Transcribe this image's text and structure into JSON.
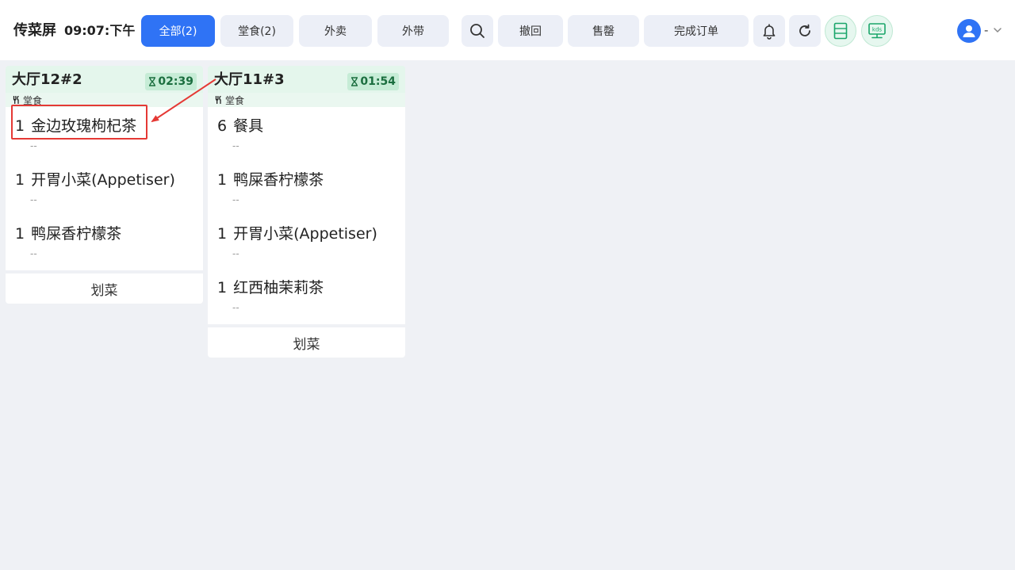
{
  "header": {
    "app_title": "传菜屏",
    "clock": "09:07:下午",
    "filters": [
      {
        "label": "全部(2)",
        "active": true
      },
      {
        "label": "堂食(2)",
        "active": false
      },
      {
        "label": "外卖",
        "active": false
      },
      {
        "label": "外带",
        "active": false
      }
    ],
    "actions": {
      "undo": "撤回",
      "sold_out": "售罄",
      "complete": "完成订单"
    },
    "icons": {
      "search": "search-icon",
      "bell": "bell-icon",
      "refresh": "refresh-icon",
      "list": "list-view-icon",
      "kds": "kds-icon",
      "kds_text": "kds"
    },
    "user": {
      "name": "-",
      "avatar": "user-avatar-icon"
    }
  },
  "orders": [
    {
      "title": "大厅12#2",
      "timer": "02:39",
      "type": "堂食",
      "items": [
        {
          "qty": "1",
          "name": "金边玫瑰枸杞茶",
          "note": "--"
        },
        {
          "qty": "1",
          "name": "开胃小菜(Appetiser)",
          "note": "--"
        },
        {
          "qty": "1",
          "name": "鸭屎香柠檬茶",
          "note": "--"
        }
      ],
      "action": "划菜"
    },
    {
      "title": "大厅11#3",
      "timer": "01:54",
      "type": "堂食",
      "items": [
        {
          "qty": "6",
          "name": "餐具",
          "note": "--"
        },
        {
          "qty": "1",
          "name": "鸭屎香柠檬茶",
          "note": "--"
        },
        {
          "qty": "1",
          "name": "开胃小菜(Appetiser)",
          "note": "--"
        },
        {
          "qty": "1",
          "name": "红西柚茉莉茶",
          "note": "--"
        }
      ],
      "action": "划菜"
    }
  ],
  "colors": {
    "primary": "#2f73f5",
    "header_green": "#e4f6ec",
    "timer_green": "#c6ecd6",
    "highlight_red": "#e53935",
    "background": "#eff1f5"
  }
}
